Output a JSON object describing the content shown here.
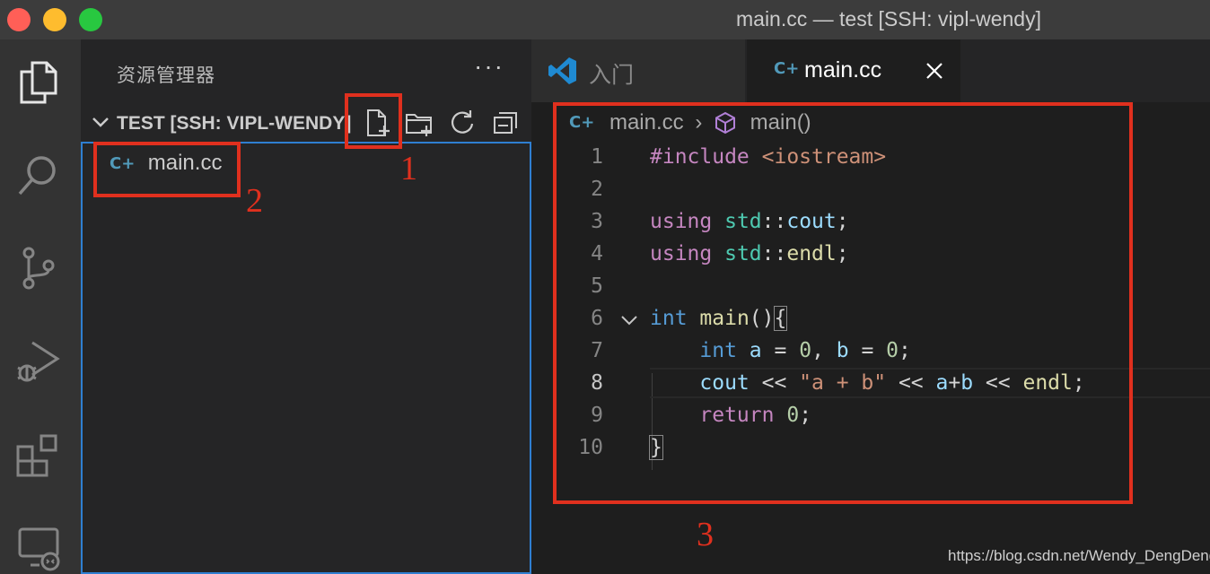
{
  "titlebar": {
    "title": "main.cc — test [SSH: vipl-wendy]"
  },
  "activitybar": {
    "icons": [
      "files-icon",
      "search-icon",
      "source-control-icon",
      "run-debug-icon",
      "extensions-icon",
      "remote-explorer-icon"
    ]
  },
  "sidebar": {
    "title": "资源管理器",
    "more": "···",
    "folder": {
      "name": "TEST [SSH: VIPL-WENDY]"
    },
    "toolbar_icons": [
      "new-file-icon",
      "new-folder-icon",
      "refresh-icon",
      "collapse-all-icon"
    ],
    "files": [
      {
        "icon": "C+",
        "name": "main.cc"
      }
    ]
  },
  "tabs": [
    {
      "label": "入门",
      "icon": "vscode-logo-icon",
      "active": false
    },
    {
      "label": "main.cc",
      "icon": "C+",
      "active": true
    }
  ],
  "breadcrumb": {
    "file_icon": "C+",
    "file": "main.cc",
    "separator": "›",
    "symbol": "main()"
  },
  "code": {
    "current_line": 8,
    "line_numbers": [
      "1",
      "2",
      "3",
      "4",
      "5",
      "6",
      "7",
      "8",
      "9",
      "10"
    ],
    "lines": [
      "#include <iostream>",
      "",
      "using std::cout;",
      "using std::endl;",
      "",
      "int main(){",
      "    int a = 0, b = 0;",
      "    cout << \"a + b\" << a+b << endl;",
      "    return 0;",
      "}"
    ]
  },
  "annotations": {
    "labels": [
      "1",
      "2",
      "3"
    ],
    "color": "#e0301e"
  },
  "watermark": "https://blog.csdn.net/Wendy_DengDeng",
  "colors": {
    "titlebar": "#3c3c3c",
    "activitybar": "#333333",
    "sidebar": "#252526",
    "editor": "#1e1e1e",
    "focus_border": "#2f7fd1"
  }
}
